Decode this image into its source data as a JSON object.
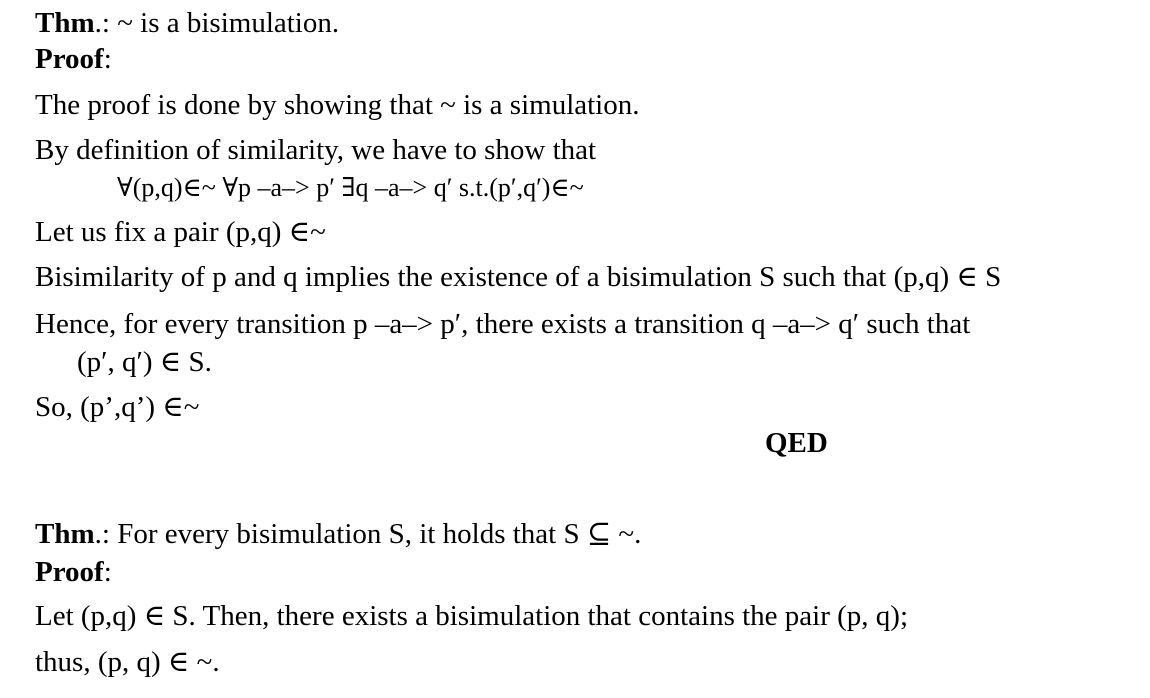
{
  "theorem1": {
    "thm_label": "Thm",
    "thm_colon": ".: ",
    "thm_text": "~ is a bisimulation.",
    "proof_label": "Proof",
    "proof_colon": ":",
    "lines": [
      "The proof is done by showing that ~ is a simulation.",
      "By definition of similarity, we have to show that",
      "∀(p,q)∈~ ∀p –a–> p′ ∃q –a–> q′ s.t.(p′,q′)∈~",
      "Let us fix a pair (p,q) ∈~",
      "Bisimilarity of p and q implies the existence of a bisimulation S such that (p,q) ∈ S",
      "Hence, for every transition p –a–> p′, there exists a transition q –a–> q′ such that",
      "(p′, q′) ∈ S.",
      "So, (p’,q’) ∈~"
    ],
    "qed": "QED"
  },
  "theorem2": {
    "thm_label": "Thm",
    "thm_colon": ".: ",
    "thm_text": "For every bisimulation S, it holds that S ⊆ ~.",
    "proof_label": "Proof",
    "proof_colon": ":",
    "lines": [
      "Let (p,q) ∈ S. Then, there exists a bisimulation that contains the pair (p, q);",
      "thus, (p, q) ∈ ~."
    ]
  }
}
